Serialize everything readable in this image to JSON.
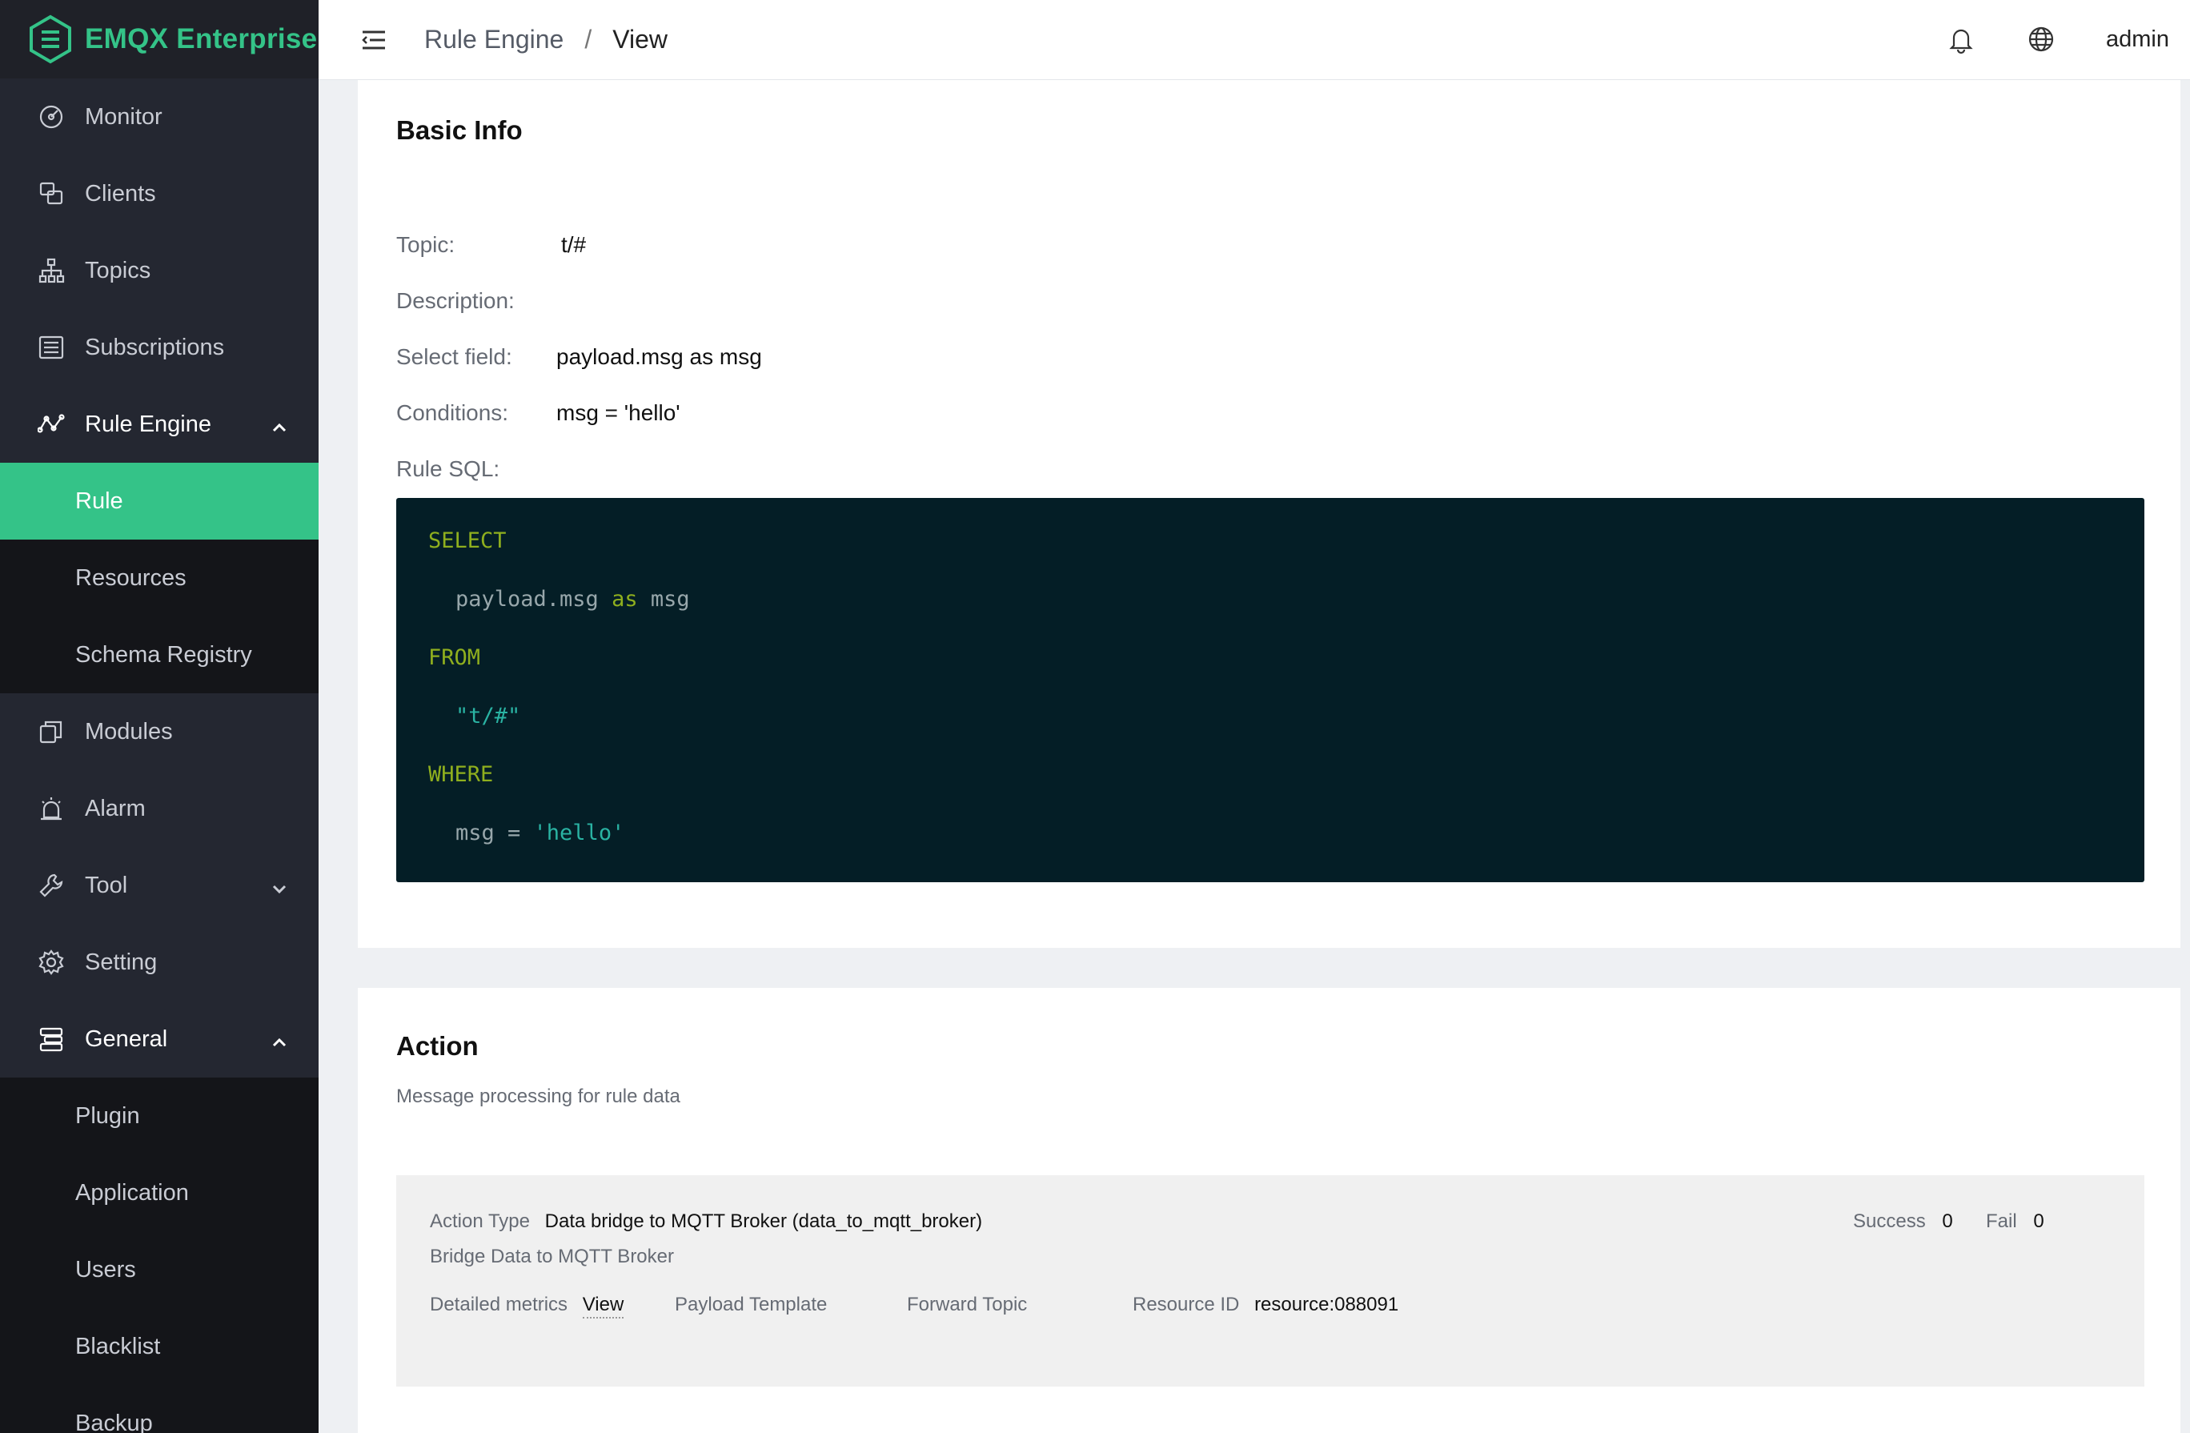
{
  "brand": {
    "name": "EMQX Enterprise"
  },
  "sidebar": {
    "items": [
      {
        "label": "Monitor",
        "icon": "dashboard-gauge-icon"
      },
      {
        "label": "Clients",
        "icon": "clients-icon"
      },
      {
        "label": "Topics",
        "icon": "topics-tree-icon"
      },
      {
        "label": "Subscriptions",
        "icon": "subscriptions-list-icon"
      },
      {
        "label": "Rule Engine",
        "icon": "rule-engine-icon",
        "expanded": true,
        "children": [
          {
            "label": "Rule",
            "active": true
          },
          {
            "label": "Resources"
          },
          {
            "label": "Schema Registry"
          }
        ]
      },
      {
        "label": "Modules",
        "icon": "modules-icon"
      },
      {
        "label": "Alarm",
        "icon": "alarm-icon"
      },
      {
        "label": "Tool",
        "icon": "tool-icon",
        "expanded": false
      },
      {
        "label": "Setting",
        "icon": "gear-icon"
      },
      {
        "label": "General",
        "icon": "general-icon",
        "expanded": true,
        "children": [
          {
            "label": "Plugin"
          },
          {
            "label": "Application"
          },
          {
            "label": "Users"
          },
          {
            "label": "Blacklist"
          },
          {
            "label": "Backup"
          }
        ]
      }
    ]
  },
  "header": {
    "breadcrumb": [
      "Rule Engine",
      "View"
    ],
    "separator": "/",
    "user": "admin"
  },
  "basic_info": {
    "title": "Basic Info",
    "topic_label": "Topic:",
    "topic_value": "t/#",
    "description_label": "Description:",
    "description_value": "",
    "select_label": "Select field:",
    "select_value": "payload.msg as msg",
    "conditions_label": "Conditions:",
    "conditions_value": "msg = 'hello'",
    "sql_label": "Rule SQL:",
    "sql": {
      "select_kw": "SELECT",
      "field": "payload.msg",
      "as_kw": "as",
      "alias": "msg",
      "from_kw": "FROM",
      "topic": "\"t/#\"",
      "where_kw": "WHERE",
      "cond_left": "msg =",
      "cond_right": "'hello'"
    }
  },
  "action": {
    "title": "Action",
    "subtitle": "Message processing for rule data",
    "type_label": "Action Type",
    "type_value": "Data bridge to MQTT Broker (data_to_mqtt_broker)",
    "type_description": "Bridge Data to MQTT Broker",
    "success_label": "Success",
    "success_value": "0",
    "fail_label": "Fail",
    "fail_value": "0",
    "metrics_label": "Detailed metrics",
    "metrics_link": "View",
    "payload_template_label": "Payload Template",
    "forward_topic_label": "Forward Topic",
    "resource_label": "Resource ID",
    "resource_value": "resource:088091"
  },
  "colors": {
    "accent": "#34c388",
    "sidebar_bg": "#242731",
    "submenu_bg": "#141519",
    "sql_bg": "#041e26",
    "sql_keyword": "#8faf1e",
    "sql_string": "#2ab3a3"
  }
}
